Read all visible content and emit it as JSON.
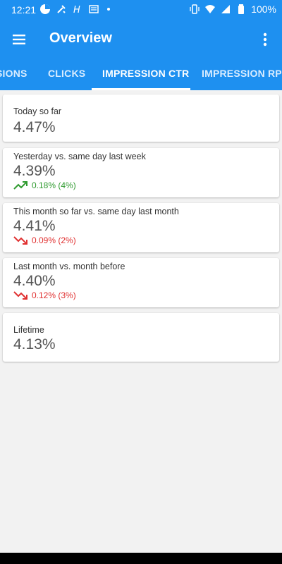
{
  "status_bar": {
    "time": "12:21",
    "battery": "100%"
  },
  "app_bar": {
    "title": "Overview"
  },
  "tabs": [
    {
      "label": "SIONS",
      "active": false
    },
    {
      "label": "CLICKS",
      "active": false
    },
    {
      "label": "IMPRESSION CTR",
      "active": true
    },
    {
      "label": "IMPRESSION RPM",
      "active": false
    }
  ],
  "cards": [
    {
      "label": "Today so far",
      "value": "4.47%"
    },
    {
      "label": "Yesterday vs. same day last week",
      "value": "4.39%",
      "delta": "0.18% (4%)",
      "trend": "up"
    },
    {
      "label": "This month so far vs. same day last month",
      "value": "4.41%",
      "delta": "0.09% (2%)",
      "trend": "down"
    },
    {
      "label": "Last month vs. month before",
      "value": "4.40%",
      "delta": "0.12% (3%)",
      "trend": "down"
    },
    {
      "label": "Lifetime",
      "value": "4.13%"
    }
  ],
  "colors": {
    "primary": "#1e90f0",
    "trend_up": "#2e9a2e",
    "trend_down": "#e03030"
  }
}
